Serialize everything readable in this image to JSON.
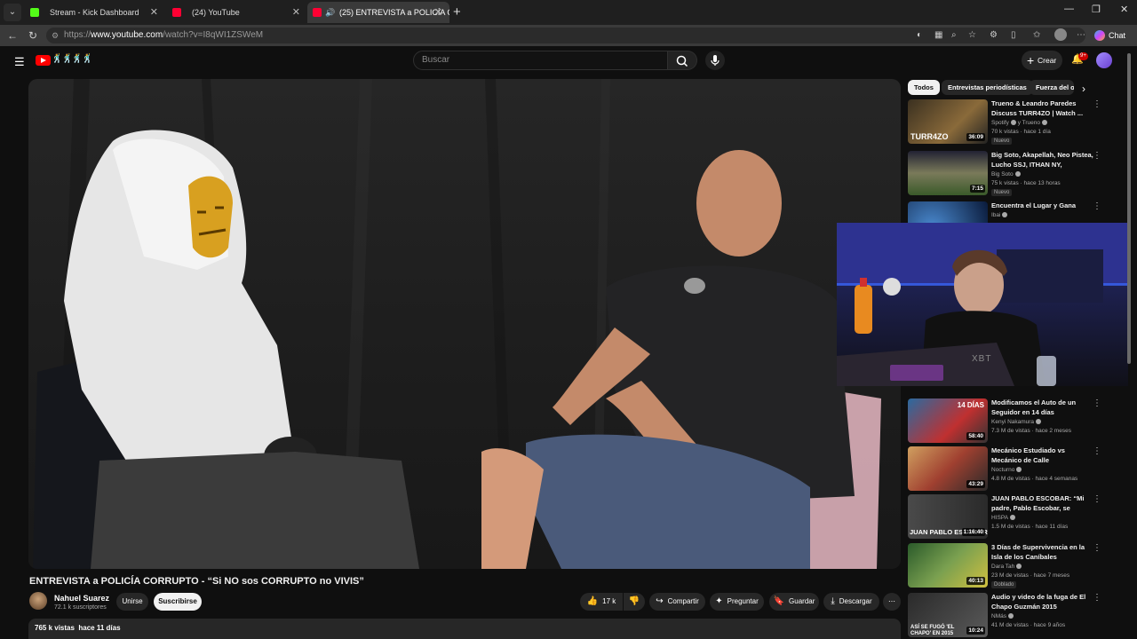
{
  "browser": {
    "tabs": [
      {
        "title": "Stream - Kick Dashboard",
        "favicon": "kick-icon",
        "active": false
      },
      {
        "title": "(24) YouTube",
        "favicon": "youtube-icon",
        "active": false
      },
      {
        "title": "(25) ENTREVISTA a POLICÍA C",
        "favicon": "youtube-icon",
        "active": true,
        "audio": true
      }
    ],
    "url_prefix": "https://",
    "url_host": "www.youtube.com",
    "url_path": "/watch?v=I8qWI1ZSWeM",
    "chat_label": "Chat"
  },
  "youtube": {
    "search_placeholder": "Buscar",
    "create_label": "Crear",
    "notifications_badge": "9+"
  },
  "video": {
    "title": "ENTREVISTA a POLICÍA CORRUPTO - “Si NO sos CORRUPTO no VIVIS”",
    "channel_name": "Nahuel Suarez",
    "subscribers": "72.1 k suscriptores",
    "join_label": "Unirse",
    "subscribe_label": "Suscribirse",
    "likes": "17 k",
    "share_label": "Compartir",
    "ask_label": "Preguntar",
    "save_label": "Guardar",
    "download_label": "Descargar",
    "views_date": "765 k vistas  hace 11 días"
  },
  "sidebar": {
    "chips": [
      "Todos",
      "Entrevistas periodísticas",
      "Fuerza del o"
    ],
    "recommendations": [
      {
        "title": "Trueno & Leandro Paredes Discuss TURR4ZO | Watch ...",
        "channel": "Spotify",
        "channel_extra": "y Trueno",
        "meta": "70 k vistas · hace 1 día",
        "badge": "Nuevo",
        "duration": "36:09"
      },
      {
        "title": "Big Soto, Akapellah, Neo Pistea, Lucho SSJ, ITHAN NY, Skiisia2,...",
        "channel": "Big Soto",
        "meta": "75 k vistas · hace 13 horas",
        "badge": "Nuevo",
        "duration": "7:15"
      },
      {
        "title": "Encuentra el Lugar y Gana",
        "channel": "Ibai"
      },
      {
        "title": "Modificamos el Auto de un Seguidor en 14 días",
        "channel": "Kenyi Nakamura",
        "meta": "7.3 M de vistas · hace 2 meses",
        "duration": "58:40"
      },
      {
        "title": "Mecánico Estudiado vs Mecánico de Calle",
        "channel": "Nocturno",
        "meta": "4.8 M de vistas · hace 4 semanas",
        "duration": "43:29"
      },
      {
        "title": "JUAN PABLO ESCOBAR: “Mi padre, Pablo Escobar, se mató,...",
        "channel": "HISPA",
        "meta": "1.5 M de vistas · hace 11 días",
        "duration": "1:16:40"
      },
      {
        "title": "3 Días de Supervivencia en la Isla de los Caníbales",
        "channel": "Dara Tah",
        "meta": "23 M de vistas · hace 7 meses",
        "badge": "Doblado",
        "duration": "40:13"
      },
      {
        "title": "Audio y video de la fuga de El Chapo Guzmán 2015",
        "channel": "NMás",
        "meta": "41 M de vistas · hace 9 años",
        "duration": "10:24"
      }
    ],
    "thumb_texts": [
      "TURR4ZO",
      "14 DÍAS",
      "JUAN PABLO ESCOBAR",
      "ASÍ SE FUGÓ 'EL CHAPO' EN 2015"
    ]
  },
  "webcam": {
    "shirt_text": "XBT"
  },
  "colors": {
    "background": "#0f0f0f",
    "youtube_red": "#ff0000",
    "chip_bg": "#272727"
  }
}
